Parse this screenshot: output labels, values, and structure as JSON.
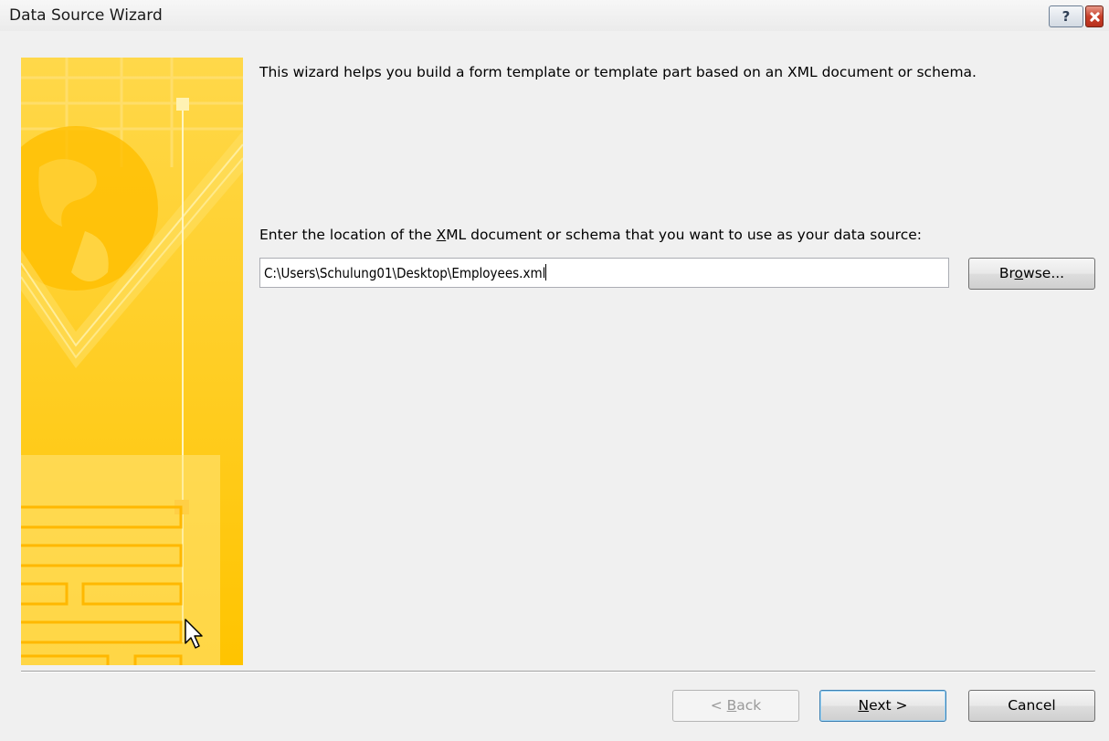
{
  "window": {
    "title": "Data Source Wizard",
    "help_label": "?"
  },
  "main": {
    "description": "This wizard helps you build a form template or template part based on an XML document or schema.",
    "prompt_before": "Enter the location of the ",
    "prompt_hot": "X",
    "prompt_after": "ML document or schema that you want to use as your data source:",
    "path_value": "C:\\Users\\Schulung01\\Desktop\\Employees.xml",
    "browse": {
      "pre": "Br",
      "hot": "o",
      "post": "wse..."
    }
  },
  "footer": {
    "back": {
      "pre": "< ",
      "hot": "B",
      "post": "ack"
    },
    "next": {
      "pre": "",
      "hot": "N",
      "post": "ext >"
    },
    "cancel": "Cancel"
  },
  "colors": {
    "banner_gold": "#ffc814",
    "dialog_bg": "#f0f0f0",
    "close_red": "#c8402a"
  }
}
